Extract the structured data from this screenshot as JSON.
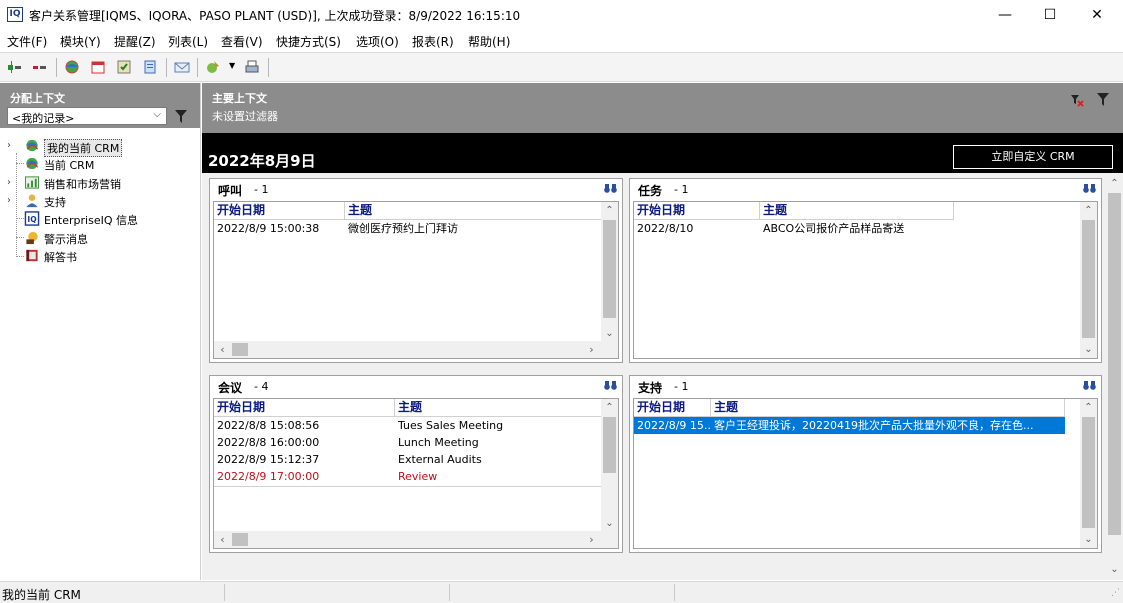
{
  "window": {
    "icon_label": "IQ",
    "title": "客户关系管理[IQMS、IQORA、PASO PLANT (USD)], 上次成功登录：8/9/2022 16:15:10",
    "minimize": "—",
    "maximize": "☐",
    "close": "✕"
  },
  "menu": [
    "文件(F)",
    "模块(Y)",
    "提醒(Z)",
    "列表(L)",
    "查看(V)",
    "快捷方式(S)",
    "选项(O)",
    "报表(R)",
    "帮助(H)"
  ],
  "left": {
    "title": "分配上下文",
    "select_value": "<我的记录>",
    "tree": [
      {
        "label": "我的当前 CRM",
        "icon": "crm-globe-icon"
      },
      {
        "label": "当前 CRM",
        "icon": "crm-globe-icon"
      },
      {
        "label": "销售和市场营销",
        "icon": "sales-chart-icon"
      },
      {
        "label": "支持",
        "icon": "support-person-icon"
      },
      {
        "label": "EnterpriseIQ 信息",
        "icon": "iq-logo-icon"
      },
      {
        "label": "警示消息",
        "icon": "alert-message-icon"
      },
      {
        "label": "解答书",
        "icon": "solution-book-icon"
      }
    ]
  },
  "main": {
    "context_title": "主要上下文",
    "context_filter": "未设置过滤器",
    "date": "2022年8月9日",
    "customize_button": "立即自定义 CRM",
    "panels": {
      "calls": {
        "title": "呼叫",
        "count": "- 1",
        "columns": [
          "开始日期",
          "主题"
        ],
        "rows": [
          [
            "2022/8/9 15:00:38",
            "微创医疗预约上门拜访"
          ]
        ]
      },
      "tasks": {
        "title": "任务",
        "count": "- 1",
        "columns": [
          "开始日期",
          "主题"
        ],
        "rows": [
          [
            "2022/8/10",
            "ABCO公司报价产品样品寄送"
          ]
        ]
      },
      "meetings": {
        "title": "会议",
        "count": "- 4",
        "columns": [
          "开始日期",
          "主题"
        ],
        "rows": [
          [
            "2022/8/8 15:08:56",
            "Tues Sales Meeting"
          ],
          [
            "2022/8/8 16:00:00",
            "Lunch Meeting"
          ],
          [
            "2022/8/9 15:12:37",
            "External Audits"
          ],
          [
            "2022/8/9 17:00:00",
            "Review"
          ]
        ]
      },
      "support": {
        "title": "支持",
        "count": "- 1",
        "columns": [
          "开始日期",
          "主题"
        ],
        "rows": [
          [
            "2022/8/9 15...",
            "客户王经理投诉，20220419批次产品大批量外观不良，存在色..."
          ]
        ]
      }
    }
  },
  "status": {
    "text": "我的当前 CRM"
  },
  "colors": {
    "header_gray": "#8c8c8c",
    "selection_blue": "#0078d7",
    "overdue_red": "#c0101a",
    "column_header_blue": "#0a1a80"
  }
}
